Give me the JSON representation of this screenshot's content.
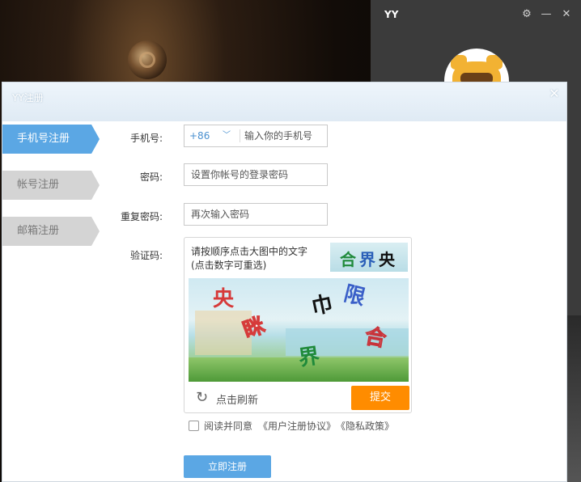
{
  "background": {
    "app_title": "YY"
  },
  "dialog": {
    "title": "YY注册"
  },
  "tabs": [
    {
      "label": "手机号注册",
      "active": true
    },
    {
      "label": "帐号注册",
      "active": false
    },
    {
      "label": "邮箱注册",
      "active": false
    }
  ],
  "form": {
    "phone_label": "手机号:",
    "country_code": "+86",
    "phone_placeholder": "输入你的手机号",
    "password_label": "密码:",
    "password_placeholder": "设置你帐号的登录密码",
    "repeat_label": "重复密码:",
    "repeat_placeholder": "再次输入密码",
    "captcha_label": "验证码:"
  },
  "captcha": {
    "instruction_line1": "请按顺序点击大图中的文字",
    "instruction_line2": "(点击数字可重选)",
    "target_chars": [
      "合",
      "界",
      "央"
    ],
    "image_chars": [
      "央",
      "巾",
      "限",
      "眯",
      "合",
      "界"
    ],
    "refresh_label": "点击刷新",
    "submit_label": "提交"
  },
  "agreement": {
    "text": "阅读并同意",
    "terms_link": "《用户注册协议》",
    "privacy_link": "《隐私政策》"
  },
  "register_button": "立即注册",
  "colors": {
    "accent_blue": "#5ba7e4",
    "submit_orange": "#ff8c00"
  }
}
